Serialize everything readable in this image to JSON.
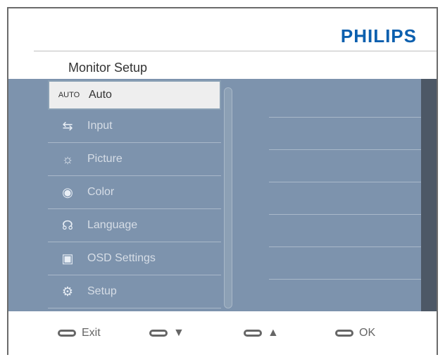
{
  "brand": "PHILIPS",
  "screen_title": "Monitor Setup",
  "menu": [
    {
      "icon_text": "AUTO",
      "label": "Auto",
      "selected": true
    },
    {
      "icon": "input-icon",
      "label": "Input",
      "selected": false
    },
    {
      "icon": "picture-icon",
      "label": "Picture",
      "selected": false
    },
    {
      "icon": "color-icon",
      "label": "Color",
      "selected": false
    },
    {
      "icon": "language-icon",
      "label": "Language",
      "selected": false
    },
    {
      "icon": "osd-icon",
      "label": "OSD Settings",
      "selected": false
    },
    {
      "icon": "setup-icon",
      "label": "Setup",
      "selected": false
    }
  ],
  "buttons": [
    {
      "label": "Exit"
    },
    {
      "label": "▼"
    },
    {
      "label": "▲"
    },
    {
      "label": "OK"
    }
  ],
  "colors": {
    "brand": "#0b5fae",
    "menu_bg": "#7d93ad",
    "selection_bg": "#eeeeee"
  }
}
